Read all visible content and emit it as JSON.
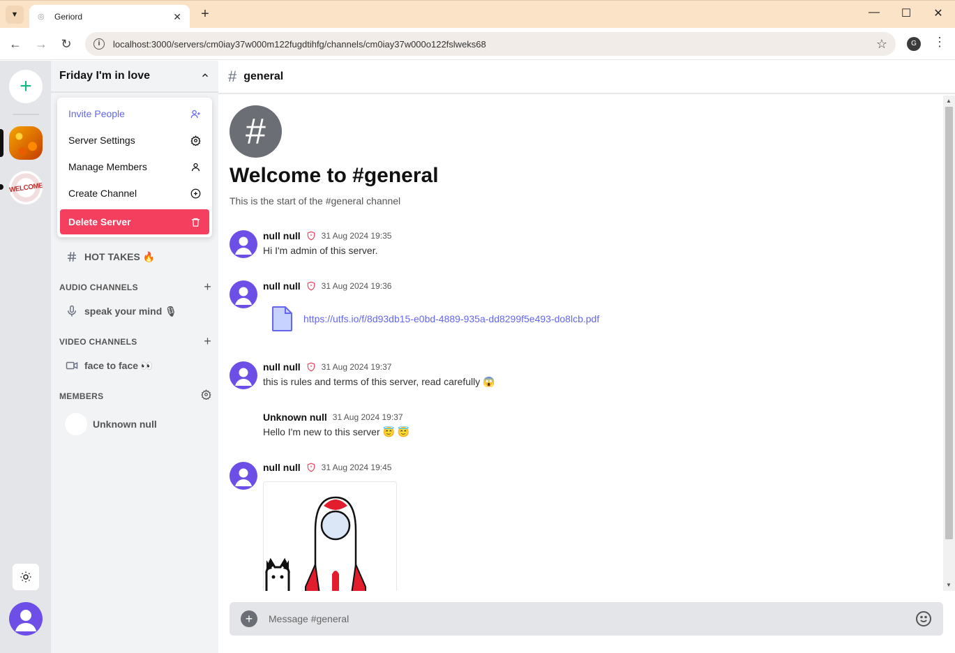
{
  "browser": {
    "tab_title": "Geriord",
    "url": "localhost:3000/servers/cm0iay37w000m122fugdtihfg/channels/cm0iay37w000o122fslweks68",
    "profile_initial": "G"
  },
  "server": {
    "name": "Friday I'm in love",
    "menu": [
      {
        "label": "Invite People",
        "icon": "user-plus-icon"
      },
      {
        "label": "Server Settings",
        "icon": "gear-icon"
      },
      {
        "label": "Manage Members",
        "icon": "user-icon"
      },
      {
        "label": "Create Channel",
        "icon": "plus-circle-icon"
      },
      {
        "label": "Delete Server",
        "icon": "trash-icon"
      }
    ],
    "text_channels": [
      {
        "name": "HOT TAKES 🔥"
      }
    ],
    "audio_section": "AUDIO CHANNELS",
    "audio_channels": [
      {
        "name": "speak your mind 🎙"
      }
    ],
    "video_section": "VIDEO CHANNELS",
    "video_channels": [
      {
        "name": "face to face 👀"
      }
    ],
    "members_section": "MEMBERS",
    "members": [
      {
        "name": "Unknown null"
      }
    ],
    "rail_server2_text": "WELCOME"
  },
  "channel": {
    "name": "general",
    "welcome_title": "Welcome to #general",
    "welcome_sub": "This is the start of the #general channel"
  },
  "messages": [
    {
      "user": "null null",
      "admin": true,
      "time": "31 Aug 2024 19:35",
      "text": "Hi I'm admin of this server."
    },
    {
      "user": "null null",
      "admin": true,
      "time": "31 Aug 2024 19:36",
      "file": "https://utfs.io/f/8d93db15-e0bd-4889-935a-dd8299f5e493-do8lcb.pdf"
    },
    {
      "user": "null null",
      "admin": true,
      "time": "31 Aug 2024 19:37",
      "text": "this is rules and terms of this server, read carefully 😱"
    },
    {
      "user": "Unknown null",
      "admin": false,
      "time": "31 Aug 2024 19:37",
      "text": "Hello I'm new to this server 😇 😇"
    },
    {
      "user": "null null",
      "admin": true,
      "time": "31 Aug 2024 19:45",
      "image": "rocket-gif"
    }
  ],
  "composer": {
    "placeholder": "Message #general"
  },
  "colors": {
    "accent": "#6366f1",
    "danger": "#f43f5e",
    "add_green": "#10b981",
    "avatar": "#6d4fe8",
    "admin_shield": "#f43f5e"
  }
}
